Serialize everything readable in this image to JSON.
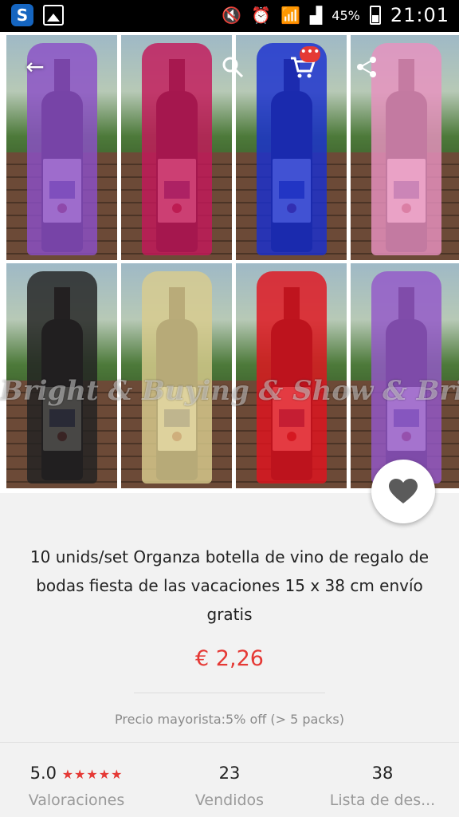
{
  "statusbar": {
    "battery": "45%",
    "time": "21:01",
    "app_letter": "S"
  },
  "product": {
    "title": "10 unids/set Organza botella de vino de regalo de bodas fiesta de las vacaciones 15 x 38 cm envío gratis",
    "price": "€ 2,26",
    "wholesale": "Precio mayorista:5% off (> 5 packs)",
    "watermark": "Bright & Buying & Show & Bright &",
    "bag_colors": [
      "#8b4fc7",
      "#c3195a",
      "#1a2fd0",
      "#e891c0",
      "#222222",
      "#d9cc8e",
      "#e0141e",
      "#9458c9"
    ],
    "image_count": 6,
    "active_image": 1
  },
  "toolbar": {
    "cart_badge": "•••"
  },
  "stats": [
    {
      "value": "5.0",
      "stars": "★★★★★",
      "label": "Valoraciones"
    },
    {
      "value": "23",
      "label": "Vendidos"
    },
    {
      "value": "38",
      "label": "Lista de des..."
    }
  ]
}
